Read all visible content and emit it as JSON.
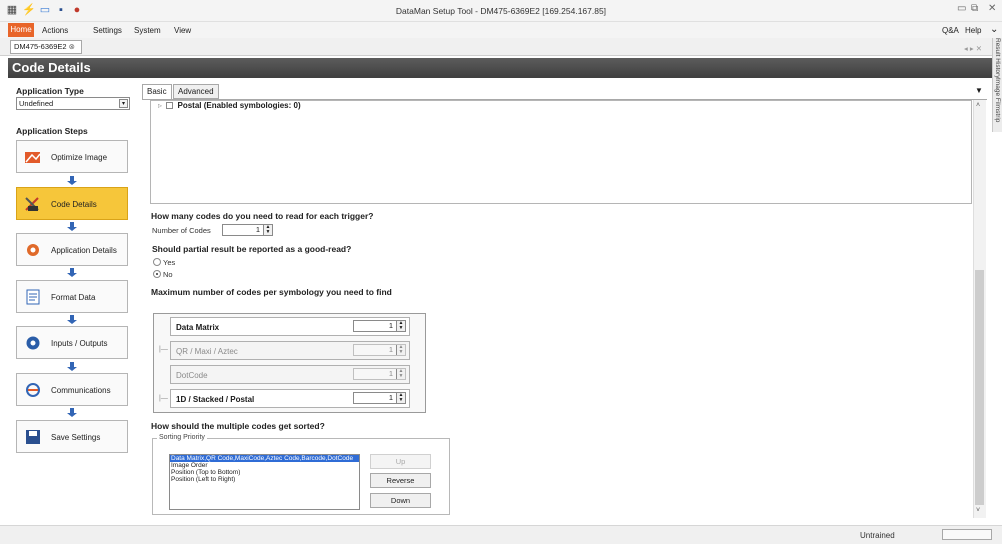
{
  "window": {
    "title": "DataMan Setup Tool - DM475-6369E2 [169.254.167.85]",
    "help_label": "Q&A",
    "help_menu": "Help"
  },
  "menu": {
    "home": "Home",
    "actions": "Actions",
    "settings": "Settings",
    "system": "System",
    "view": "View"
  },
  "doc_tab": "DM475-6369E2",
  "side_panels": [
    "Result History",
    "Image Filmstrip"
  ],
  "page_title": "Code Details",
  "left": {
    "application_type_label": "Application Type",
    "application_type_value": "Undefined",
    "application_steps_label": "Application Steps",
    "steps": [
      {
        "label": "Optimize Image",
        "icon": "optimize-image-icon",
        "active": false
      },
      {
        "label": "Code Details",
        "icon": "code-details-icon",
        "active": true
      },
      {
        "label": "Application Details",
        "icon": "application-details-icon",
        "active": false
      },
      {
        "label": "Format Data",
        "icon": "format-data-icon",
        "active": false
      },
      {
        "label": "Inputs / Outputs",
        "icon": "inputs-outputs-icon",
        "active": false
      },
      {
        "label": "Communications",
        "icon": "communications-icon",
        "active": false
      },
      {
        "label": "Save Settings",
        "icon": "save-settings-icon",
        "active": false
      }
    ]
  },
  "tabs": {
    "basic": "Basic",
    "advanced": "Advanced"
  },
  "symbology_list": {
    "postal": "Postal (Enabled symbologies: 0)"
  },
  "codes_per_trigger": {
    "question": "How many codes do you need to read for each trigger?",
    "label": "Number of Codes",
    "value": "1"
  },
  "partial_result": {
    "question": "Should partial result be reported as a good-read?",
    "yes": "Yes",
    "no": "No",
    "selected": "No"
  },
  "max_codes": {
    "question": "Maximum number of codes per symbology you need to find",
    "rows": [
      {
        "name": "Data Matrix",
        "value": "1",
        "enabled": true
      },
      {
        "name": "QR / Maxi / Aztec",
        "value": "1",
        "enabled": false
      },
      {
        "name": "DotCode",
        "value": "1",
        "enabled": false
      },
      {
        "name": "1D / Stacked / Postal",
        "value": "1",
        "enabled": true
      }
    ]
  },
  "sorting": {
    "question": "How should the multiple codes get sorted?",
    "group_label": "Sorting Priority",
    "items": [
      "Data Matrix,QR Code,MaxiCode,Aztec Code,Barcode,DotCode",
      "Image Order",
      "Position (Top to Bottom)",
      "Position (Left to Right)"
    ],
    "buttons": {
      "up": "Up",
      "reverse": "Reverse",
      "down": "Down"
    }
  },
  "status": {
    "text": "Untrained"
  },
  "colors": {
    "accent_orange": "#e8652a",
    "active_step": "#f6c63a",
    "selection_blue": "#2f6cd6"
  }
}
